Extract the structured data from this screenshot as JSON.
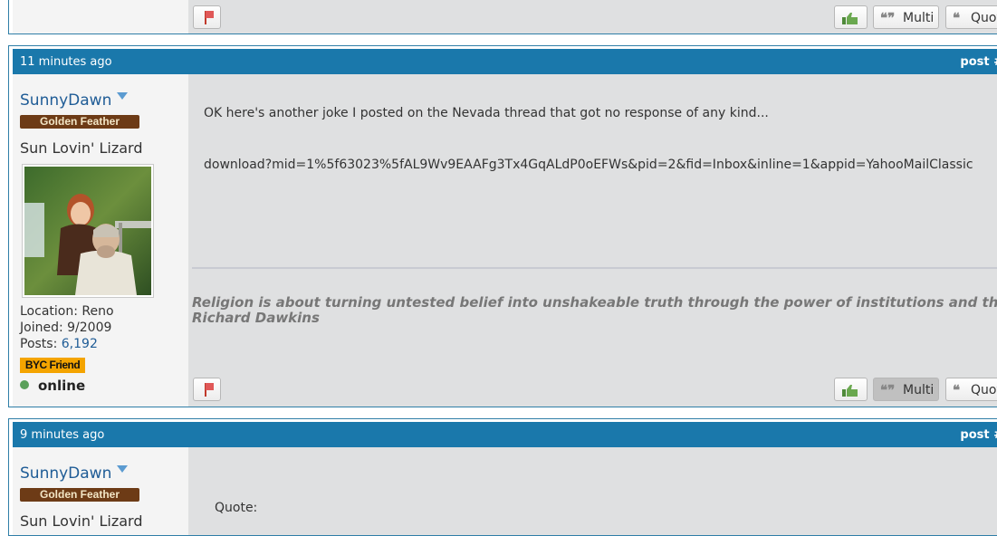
{
  "top_post": {
    "buttons": {
      "multi": "Multi",
      "quote": "Quot"
    }
  },
  "post1": {
    "time": "11 minutes ago",
    "post_link": "post #",
    "user": {
      "name": "SunnyDawn",
      "rank_badge": "Golden Feather",
      "title": "Sun Lovin' Lizard",
      "location_label": "Location:",
      "location": "Reno",
      "joined_label": "Joined:",
      "joined": "9/2009",
      "posts_label": "Posts:",
      "posts": "6,192",
      "friend_badge": "BYC Friend",
      "status": "online"
    },
    "message": {
      "line1": "OK here's another joke I posted on the Nevada thread that got no response of any kind...",
      "line2": "download?mid=1%5f63023%5fAL9Wv9EAAFg3Tx4GqALdP0oEFWs&pid=2&fid=Inbox&inline=1&appid=YahooMailClassic"
    },
    "signature": {
      "quote": "Religion is about turning untested belief into unshakeable truth through the power of institutions and the passage",
      "author": "Richard Dawkins"
    },
    "buttons": {
      "multi": "Multi",
      "quote": "Quot"
    }
  },
  "post2": {
    "time": "9 minutes ago",
    "post_link": "post #",
    "user": {
      "name": "SunnyDawn",
      "rank_badge": "Golden Feather",
      "title": "Sun Lovin' Lizard"
    },
    "message": {
      "quote_label": "Quote:"
    }
  },
  "icons": {
    "report": "flag-icon",
    "like": "thumbs-up-icon",
    "multi": "multi-quote-icon",
    "quote": "quote-icon",
    "dropdown": "chevron-down-icon",
    "status": "online-dot-icon"
  },
  "colors": {
    "header": "#1a78ab",
    "username": "#1f5c96",
    "rank_badge": "#6d3b16",
    "friend_badge": "#f4a400",
    "online": "#5aa05a"
  }
}
